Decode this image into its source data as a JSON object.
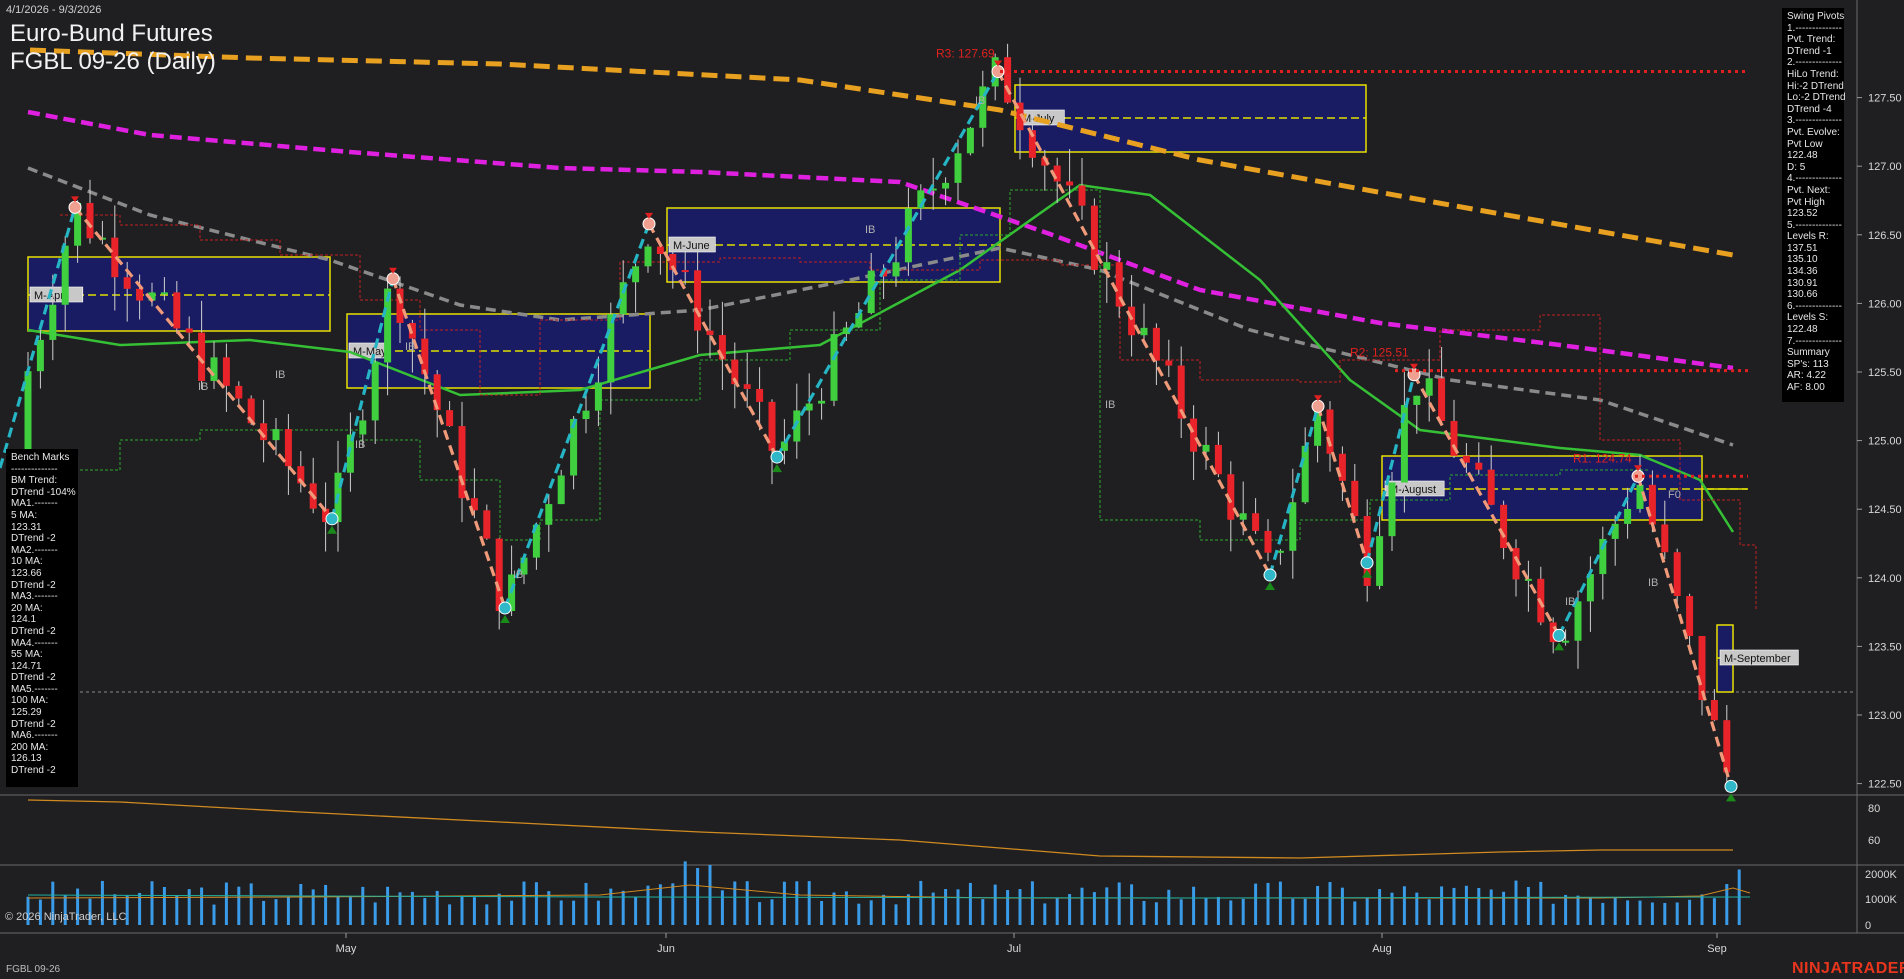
{
  "header": {
    "date_range": "4/1/2026 - 9/3/2026",
    "title_line1": "Euro-Bund Futures",
    "title_line2": "FGBL 09-26 (Daily)"
  },
  "footer": {
    "symbol": "FGBL 09-26",
    "copyright": "© 2026 NinjaTrader, LLC",
    "brand": "NINJATRADER"
  },
  "swing_panel": [
    "Swing Pivots",
    "1.--------------",
    "Pvt. Trend:",
    "DTrend -1",
    "2.--------------",
    "HiLo Trend:",
    "Hi:-2 DTrend",
    "Lo:-2 DTrend",
    "DTrend -4",
    "3.--------------",
    "Pvt. Evolve:",
    "Pvt Low",
    "122.48",
    "D: 5",
    "4.--------------",
    "Pvt. Next:",
    "Pvt High",
    "123.52",
    "5.--------------",
    "Levels R:",
    "137.51",
    "135.10",
    "134.36",
    "130.91",
    "130.66",
    "6.--------------",
    "Levels S:",
    "122.48",
    "7.--------------",
    "Summary",
    "SP's: 113",
    "AR: 4.22",
    "AF: 8.00"
  ],
  "bench_panel": [
    "Bench Marks",
    "--------------",
    "BM Trend:",
    "DTrend -104%",
    "MA1.-------",
    "5 MA:",
    "123.31",
    "DTrend -2",
    "MA2.-------",
    "10 MA:",
    "123.66",
    "DTrend -2",
    "MA3.-------",
    "20 MA:",
    "124.1",
    "DTrend -2",
    "MA4.-------",
    "55 MA:",
    "124.71",
    "DTrend -2",
    "MA5.-------",
    "100 MA:",
    "125.29",
    "DTrend -2",
    "MA6.-------",
    "200 MA:",
    "126.13",
    "DTrend -2"
  ],
  "chart_data": {
    "type": "candlestick",
    "price_axis": {
      "ticks": [
        "127.50",
        "127.00",
        "126.50",
        "126.00",
        "125.50",
        "125.00",
        "124.50",
        "124.00",
        "123.50",
        "123.00",
        "122.50"
      ],
      "range": [
        122.0,
        128.0
      ]
    },
    "oscillator_axis": {
      "ticks": [
        "80",
        "60"
      ]
    },
    "volume_axis": {
      "ticks": [
        "2000K",
        "1000K",
        "0"
      ]
    },
    "x_axis": {
      "months": [
        "May",
        "Jun",
        "Jul",
        "Aug",
        "Sep"
      ]
    },
    "resistance_labels": [
      {
        "text": "R3: 127.69",
        "value": 127.69
      },
      {
        "text": "R2: 125.51",
        "value": 125.51
      },
      {
        "text": "R1: 124.74",
        "value": 124.74
      }
    ],
    "monthly_boxes": [
      {
        "label": "M-April"
      },
      {
        "label": "M-May"
      },
      {
        "label": "M-June"
      },
      {
        "label": "M-July"
      },
      {
        "label": "M-August"
      },
      {
        "label": "M-September"
      }
    ],
    "markers": [
      "IB",
      "F0"
    ],
    "colors": {
      "background": "#1f1f21",
      "bull_candle": "#3fcf3f",
      "bear_candle": "#e8232a",
      "swing_up": "#26b5c4",
      "swing_down": "#f09a7a",
      "ma_magenta": "#e020e0",
      "ma_orange": "#e8a020",
      "ma_gray": "#8a8a8a",
      "ma_green": "#35c035",
      "resistance": "#e0201f",
      "box_fill": "#1a1c6e",
      "box_border": "#e8e000",
      "volume_bar": "#3a9be8"
    }
  }
}
